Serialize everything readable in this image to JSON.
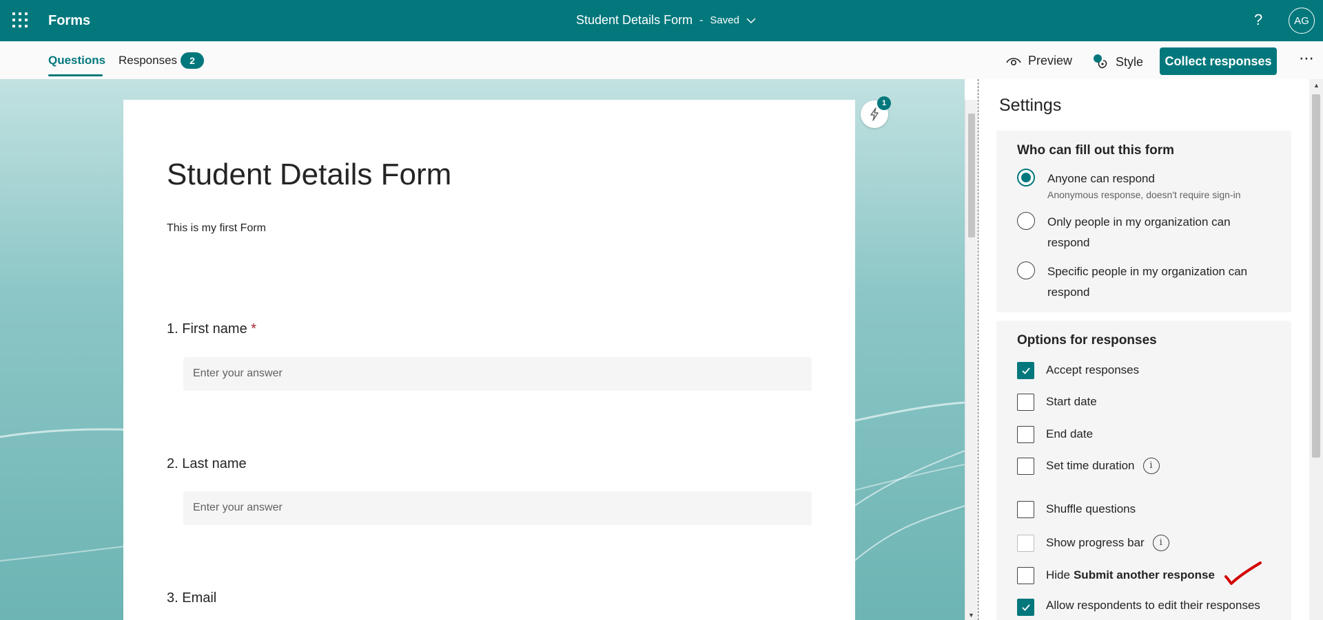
{
  "appbar": {
    "app_name": "Forms",
    "form_title": "Student Details Form",
    "separator": "-",
    "save_status": "Saved",
    "help": "?",
    "avatar_initials": "AG"
  },
  "tabs": {
    "questions": "Questions",
    "responses": "Responses",
    "responses_count": "2"
  },
  "commands": {
    "preview": "Preview",
    "style": "Style",
    "collect": "Collect responses",
    "more": "⋯"
  },
  "form": {
    "title": "Student Details Form",
    "description": "This is my first Form",
    "questions": [
      {
        "label": "1. First name",
        "required": "*",
        "placeholder": "Enter your answer"
      },
      {
        "label": "2. Last name",
        "placeholder": "Enter your answer"
      },
      {
        "label": "3. Email"
      }
    ],
    "suggestions_count": "1"
  },
  "settings": {
    "title": "Settings",
    "who": {
      "title": "Who can fill out this form",
      "options": [
        {
          "label": "Anyone can respond",
          "sub": "Anonymous response, doesn't require sign-in",
          "selected": true
        },
        {
          "label": "Only people in my organization can respond",
          "selected": false
        },
        {
          "label": "Specific people in my organization can respond",
          "selected": false
        }
      ]
    },
    "options": {
      "title": "Options for responses",
      "items": [
        {
          "label": "Accept responses",
          "checked": true
        },
        {
          "label": "Start date",
          "checked": false
        },
        {
          "label": "End date",
          "checked": false
        },
        {
          "label": "Set time duration",
          "checked": false,
          "info": "i"
        },
        {
          "label": "Shuffle questions",
          "checked": false
        },
        {
          "label": "Show progress bar",
          "checked": false,
          "info": "i"
        },
        {
          "label_prefix": "Hide",
          "label_bold": "Submit another response",
          "checked": false
        },
        {
          "label": "Allow respondents to edit their responses",
          "checked": true
        }
      ]
    }
  },
  "colors": {
    "brand": "#03787c",
    "required": "#a4262c",
    "annotation": "#d40000"
  }
}
